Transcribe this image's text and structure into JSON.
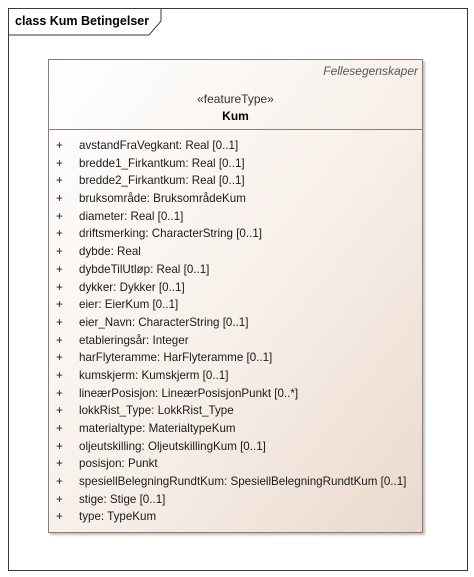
{
  "frame": {
    "title": "class Kum Betingelser"
  },
  "class": {
    "package": "Fellesegenskaper",
    "stereotype": "«featureType»",
    "name": "Kum",
    "attributes": [
      {
        "vis": "+",
        "text": "avstandFraVegkant: Real [0..1]"
      },
      {
        "vis": "+",
        "text": "bredde1_Firkantkum: Real [0..1]"
      },
      {
        "vis": "+",
        "text": "bredde2_Firkantkum: Real [0..1]"
      },
      {
        "vis": "+",
        "text": "bruksområde: BruksområdeKum"
      },
      {
        "vis": "+",
        "text": "diameter: Real [0..1]"
      },
      {
        "vis": "+",
        "text": "driftsmerking: CharacterString [0..1]"
      },
      {
        "vis": "+",
        "text": "dybde: Real"
      },
      {
        "vis": "+",
        "text": "dybdeTilUtløp: Real [0..1]"
      },
      {
        "vis": "+",
        "text": "dykker: Dykker [0..1]"
      },
      {
        "vis": "+",
        "text": "eier: EierKum [0..1]"
      },
      {
        "vis": "+",
        "text": "eier_Navn: CharacterString [0..1]"
      },
      {
        "vis": "+",
        "text": "etableringsår: Integer"
      },
      {
        "vis": "+",
        "text": "harFlyteramme: HarFlyteramme [0..1]"
      },
      {
        "vis": "+",
        "text": "kumskjerm: Kumskjerm [0..1]"
      },
      {
        "vis": "+",
        "text": "lineærPosisjon: LineærPosisjonPunkt [0..*]"
      },
      {
        "vis": "+",
        "text": "lokkRist_Type: LokkRist_Type"
      },
      {
        "vis": "+",
        "text": "materialtype: MaterialtypeKum"
      },
      {
        "vis": "+",
        "text": "oljeutskilling: OljeutskillingKum [0..1]"
      },
      {
        "vis": "+",
        "text": "posisjon: Punkt"
      },
      {
        "vis": "+",
        "text": "spesiellBelegningRundtKum: SpesiellBelegningRundtKum [0..1]"
      },
      {
        "vis": "+",
        "text": "stige: Stige [0..1]"
      },
      {
        "vis": "+",
        "text": "type: TypeKum"
      }
    ]
  }
}
